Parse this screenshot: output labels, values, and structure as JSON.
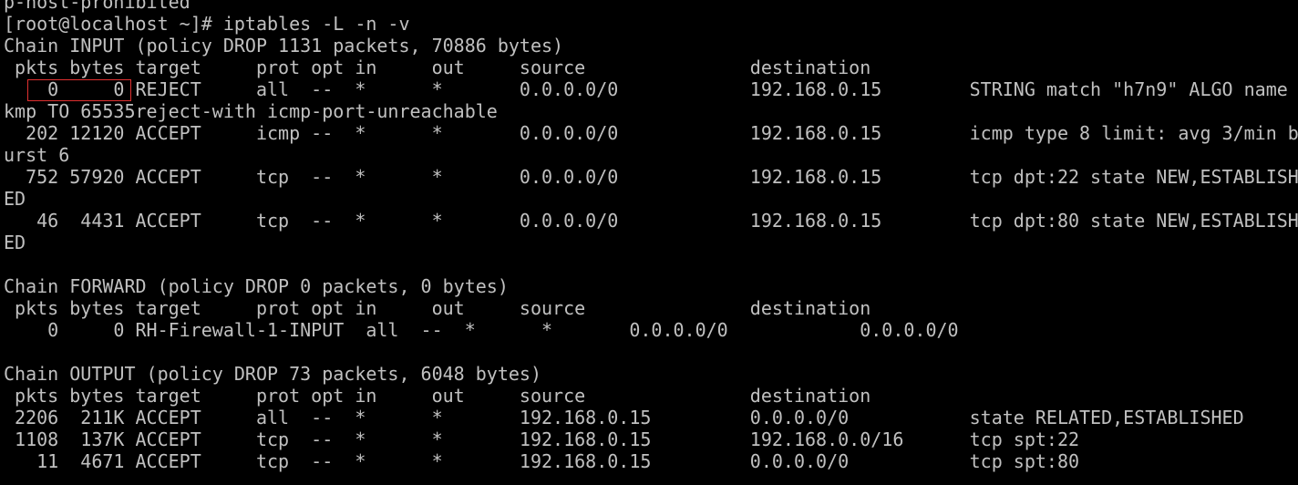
{
  "terminal": {
    "lines": [
      "p-host-prohibited",
      "[root@localhost ~]# iptables -L -n -v",
      "Chain INPUT (policy DROP 1131 packets, 70886 bytes)",
      " pkts bytes target     prot opt in     out     source               destination",
      "    0     0 REJECT     all  --  *      *       0.0.0.0/0            192.168.0.15        STRING match \"h7n9\" ALGO name",
      "kmp TO 65535reject-with icmp-port-unreachable",
      "  202 12120 ACCEPT     icmp --  *      *       0.0.0.0/0            192.168.0.15        icmp type 8 limit: avg 3/min b",
      "urst 6",
      "  752 57920 ACCEPT     tcp  --  *      *       0.0.0.0/0            192.168.0.15        tcp dpt:22 state NEW,ESTABLISH",
      "ED",
      "   46  4431 ACCEPT     tcp  --  *      *       0.0.0.0/0            192.168.0.15        tcp dpt:80 state NEW,ESTABLISH",
      "ED",
      "",
      "Chain FORWARD (policy DROP 0 packets, 0 bytes)",
      " pkts bytes target     prot opt in     out     source               destination",
      "    0     0 RH-Firewall-1-INPUT  all  --  *      *       0.0.0.0/0            0.0.0.0/0",
      "",
      "Chain OUTPUT (policy DROP 73 packets, 6048 bytes)",
      " pkts bytes target     prot opt in     out     source               destination",
      " 2206  211K ACCEPT     all  --  *      *       192.168.0.15         0.0.0.0/0           state RELATED,ESTABLISHED",
      " 1108  137K ACCEPT     tcp  --  *      *       192.168.0.15         192.168.0.0/16      tcp spt:22",
      "   11  4671 ACCEPT     tcp  --  *      *       192.168.0.15         0.0.0.0/0           tcp spt:80"
    ]
  },
  "colors": {
    "background": "#000000",
    "text": "#c0c0c0",
    "highlight_border": "#e03030"
  }
}
